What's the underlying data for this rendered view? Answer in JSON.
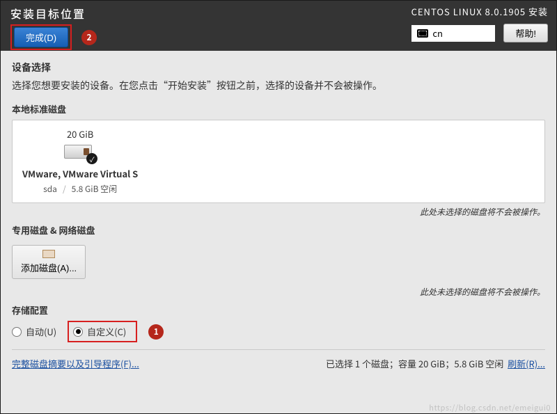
{
  "header": {
    "title": "安装目标位置",
    "done_label": "完成(D)",
    "badge2": "2",
    "product": "CENTOS LINUX 8.0.1905 安装",
    "lang": "cn",
    "help_label": "帮助!"
  },
  "device_select": {
    "title": "设备选择",
    "desc": "选择您想要安装的设备。在您点击“开始安装”按钮之前，选择的设备并不会被操作。"
  },
  "local_disk": {
    "title": "本地标准磁盘",
    "disk": {
      "size": "20 GiB",
      "label": "VMware, VMware Virtual S",
      "dev": "sda",
      "free": "5.8 GiB 空闲"
    },
    "note": "此处未选择的磁盘将不会被操作。"
  },
  "special_disk": {
    "title": "专用磁盘 & 网络磁盘",
    "add_label": "添加磁盘(A)...",
    "note": "此处未选择的磁盘将不会被操作。"
  },
  "storage": {
    "title": "存储配置",
    "auto": "自动(U)",
    "custom": "自定义(C)",
    "badge1": "1"
  },
  "footer": {
    "summary_link": "完整磁盘摘要以及引导程序(F)...",
    "status": "已选择 1 个磁盘；容量 20 GiB；5.8 GiB 空闲",
    "refresh": "刷新(R)..."
  },
  "watermark": "https://blog.csdn.net/emeigui0"
}
